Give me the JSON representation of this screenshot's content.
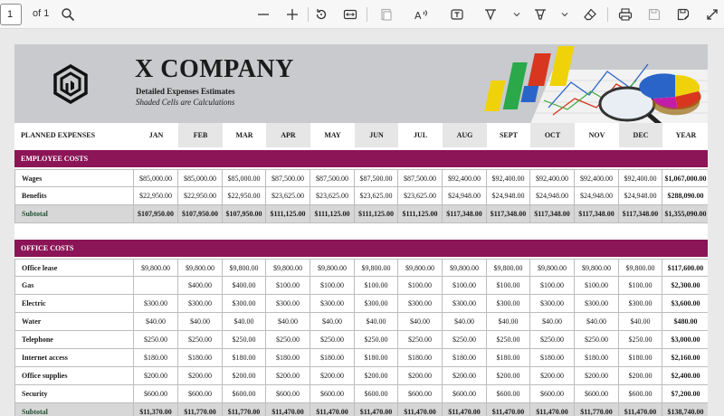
{
  "toolbar": {
    "page_value": "1",
    "page_of": "of 1",
    "icons": [
      "search-icon",
      "zoom-out-icon",
      "zoom-in-icon",
      "rotate-icon",
      "fit-width-icon",
      "page-view-icon",
      "read-aloud-icon",
      "text-box-icon",
      "draw-icon",
      "highlight-icon",
      "eraser-icon",
      "print-icon",
      "save-icon",
      "save-as-icon",
      "fullscreen-icon"
    ]
  },
  "banner": {
    "title": "X COMPANY",
    "subtitle": "Detailed Expenses Estimates",
    "note": "Shaded Cells are Calculations"
  },
  "table": {
    "corner_label": "PLANNED EXPENSES",
    "months": [
      "JAN",
      "FEB",
      "MAR",
      "APR",
      "MAY",
      "JUN",
      "JUL",
      "AUG",
      "SEPT",
      "OCT",
      "NOV",
      "DEC"
    ],
    "year_label": "YEAR",
    "sections": [
      {
        "title": "EMPLOYEE COSTS",
        "rows": [
          {
            "label": "Wages",
            "values": [
              "$85,000.00",
              "$85,000.00",
              "$85,000.00",
              "$87,500.00",
              "$87,500.00",
              "$87,500.00",
              "$87,500.00",
              "$92,400.00",
              "$92,400.00",
              "$92,400.00",
              "$92,400.00",
              "$92,400.00"
            ],
            "total": "$1,067,000.00"
          },
          {
            "label": "Benefits",
            "values": [
              "$22,950.00",
              "$22,950.00",
              "$22,950.00",
              "$23,625.00",
              "$23,625.00",
              "$23,625.00",
              "$23,625.00",
              "$24,948.00",
              "$24,948.00",
              "$24,948.00",
              "$24,948.00",
              "$24,948.00"
            ],
            "total": "$288,090.00"
          }
        ],
        "subtotal": {
          "label": "Subtotal",
          "values": [
            "$107,950.00",
            "$107,950.00",
            "$107,950.00",
            "$111,125.00",
            "$111,125.00",
            "$111,125.00",
            "$111,125.00",
            "$117,348.00",
            "$117,348.00",
            "$117,348.00",
            "$117,348.00",
            "$117,348.00"
          ],
          "total": "$1,355,090.00"
        }
      },
      {
        "title": "OFFICE COSTS",
        "rows": [
          {
            "label": "Office lease",
            "values": [
              "$9,800.00",
              "$9,800.00",
              "$9,800.00",
              "$9,800.00",
              "$9,800.00",
              "$9,800.00",
              "$9,800.00",
              "$9,800.00",
              "$9,800.00",
              "$9,800.00",
              "$9,800.00",
              "$9,800.00"
            ],
            "total": "$117,600.00"
          },
          {
            "label": "Gas",
            "values": [
              "",
              "$400.00",
              "$400.00",
              "$100.00",
              "$100.00",
              "$100.00",
              "$100.00",
              "$100.00",
              "$100.00",
              "$100.00",
              "$100.00",
              "$100.00"
            ],
            "total": "$2,300.00"
          },
          {
            "label": "Electric",
            "values": [
              "$300.00",
              "$300.00",
              "$300.00",
              "$300.00",
              "$300.00",
              "$300.00",
              "$300.00",
              "$300.00",
              "$300.00",
              "$300.00",
              "$300.00",
              "$300.00"
            ],
            "total": "$3,600.00"
          },
          {
            "label": "Water",
            "values": [
              "$40.00",
              "$40.00",
              "$40.00",
              "$40.00",
              "$40.00",
              "$40.00",
              "$40.00",
              "$40.00",
              "$40.00",
              "$40.00",
              "$40.00",
              "$40.00"
            ],
            "total": "$480.00"
          },
          {
            "label": "Telephone",
            "values": [
              "$250.00",
              "$250.00",
              "$250.00",
              "$250.00",
              "$250.00",
              "$250.00",
              "$250.00",
              "$250.00",
              "$250.00",
              "$250.00",
              "$250.00",
              "$250.00"
            ],
            "total": "$3,000.00"
          },
          {
            "label": "Internet access",
            "values": [
              "$180.00",
              "$180.00",
              "$180.00",
              "$180.00",
              "$180.00",
              "$180.00",
              "$180.00",
              "$180.00",
              "$180.00",
              "$180.00",
              "$180.00",
              "$180.00"
            ],
            "total": "$2,160.00"
          },
          {
            "label": "Office supplies",
            "values": [
              "$200.00",
              "$200.00",
              "$200.00",
              "$200.00",
              "$200.00",
              "$200.00",
              "$200.00",
              "$200.00",
              "$200.00",
              "$200.00",
              "$200.00",
              "$200.00"
            ],
            "total": "$2,400.00"
          },
          {
            "label": "Security",
            "values": [
              "$600.00",
              "$600.00",
              "$600.00",
              "$600.00",
              "$600.00",
              "$600.00",
              "$600.00",
              "$600.00",
              "$600.00",
              "$600.00",
              "$600.00",
              "$600.00"
            ],
            "total": "$7,200.00"
          }
        ],
        "subtotal": {
          "label": "Subtotal",
          "values": [
            "$11,370.00",
            "$11,770.00",
            "$11,770.00",
            "$11,470.00",
            "$11,470.00",
            "$11,470.00",
            "$11,470.00",
            "$11,470.00",
            "$11,470.00",
            "$11,470.00",
            "$11,770.00",
            "$11,470.00"
          ],
          "total": "$138,740.00"
        }
      }
    ]
  },
  "colors": {
    "section_bar": "#8b1556",
    "banner_bg": "#c8cacd",
    "subtotal_bg": "#d7d7d7",
    "header_shaded": "#e6e6e6"
  }
}
